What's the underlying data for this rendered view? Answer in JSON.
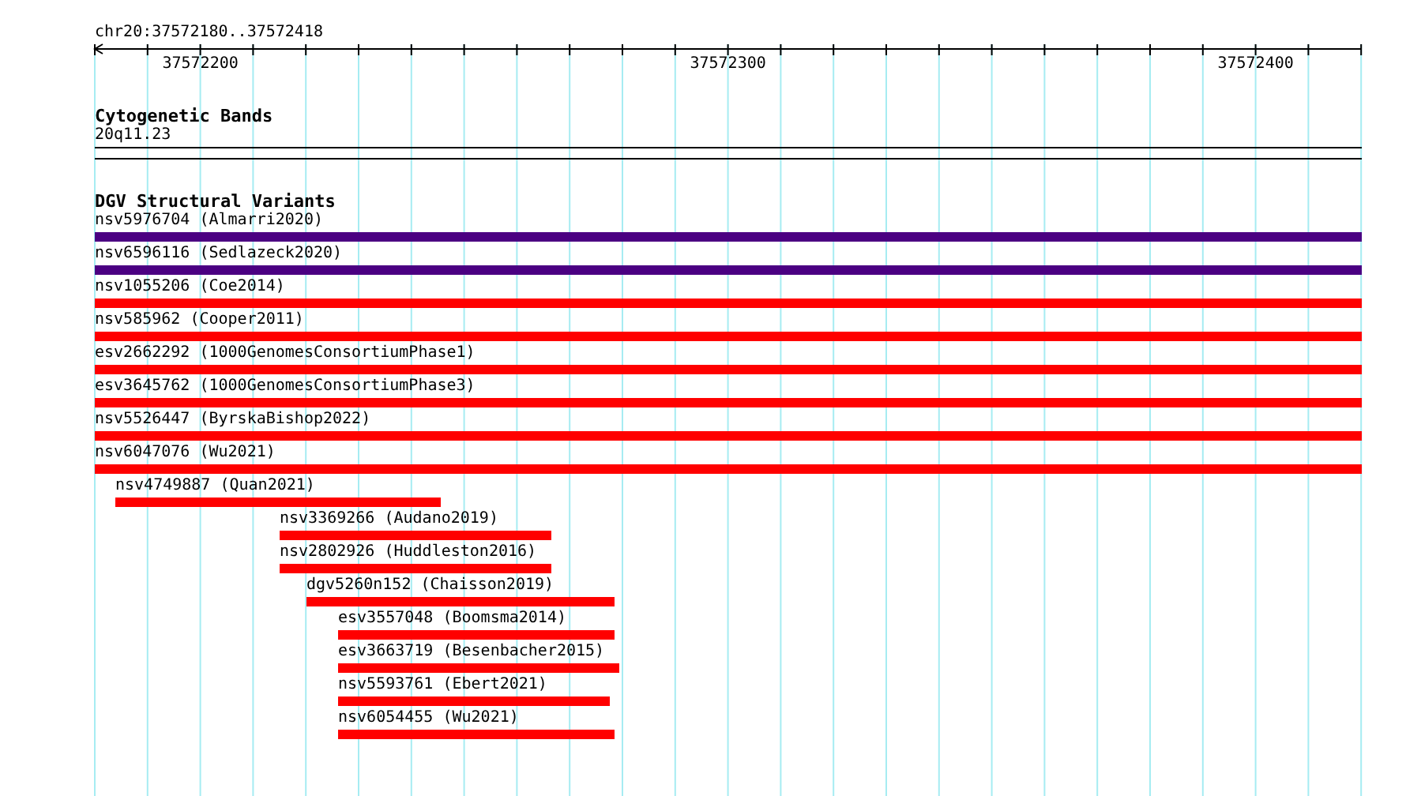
{
  "ruler": {
    "location": "chr20:37572180..37572418",
    "tick_labels": [
      "37572200",
      "37572300",
      "37572400"
    ]
  },
  "tracks": [
    {
      "kind": "bands",
      "title": "Cytogenetic Bands",
      "features": [
        {
          "label": "20q11.23"
        }
      ]
    },
    {
      "kind": "variants",
      "title": "DGV Structural Variants",
      "features": [
        {
          "label": "nsv5976704 (Almarri2020)",
          "color": "#4b0082"
        },
        {
          "label": "nsv6596116 (Sedlazeck2020)",
          "color": "#4b0082"
        },
        {
          "label": "nsv1055206 (Coe2014)",
          "color": "#ff0000"
        },
        {
          "label": "nsv585962 (Cooper2011)",
          "color": "#ff0000"
        },
        {
          "label": "esv2662292 (1000GenomesConsortiumPhase1)",
          "color": "#ff0000"
        },
        {
          "label": "esv3645762 (1000GenomesConsortiumPhase3)",
          "color": "#ff0000"
        },
        {
          "label": "nsv5526447 (ByrskaBishop2022)",
          "color": "#ff0000"
        },
        {
          "label": "nsv6047076 (Wu2021)",
          "color": "#ff0000"
        },
        {
          "label": "nsv4749887 (Quan2021)",
          "color": "#ff0000"
        },
        {
          "label": "nsv3369266 (Audano2019)",
          "color": "#ff0000"
        },
        {
          "label": "nsv2802926 (Huddleston2016)",
          "color": "#ff0000"
        },
        {
          "label": "dgv5260n152 (Chaisson2019)",
          "color": "#ff0000"
        },
        {
          "label": "esv3557048 (Boomsma2014)",
          "color": "#ff0000"
        },
        {
          "label": "esv3663719 (Besenbacher2015)",
          "color": "#ff0000"
        },
        {
          "label": "nsv5593761 (Ebert2021)",
          "color": "#ff0000"
        },
        {
          "label": "nsv6054455 (Wu2021)",
          "color": "#ff0000"
        }
      ]
    }
  ]
}
